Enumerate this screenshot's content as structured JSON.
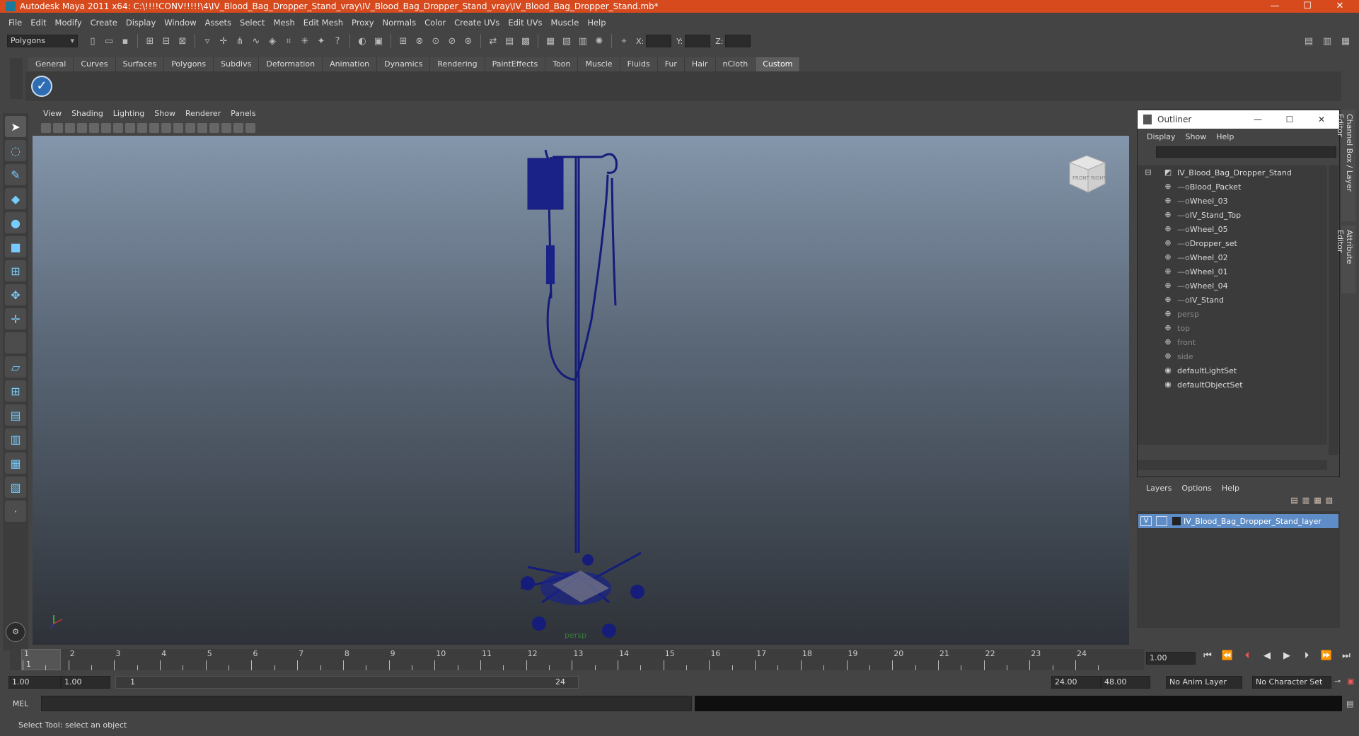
{
  "window": {
    "title": "Autodesk Maya 2011 x64: C:\\!!!!CONV!!!!!\\4\\IV_Blood_Bag_Dropper_Stand_vray\\IV_Blood_Bag_Dropper_Stand_vray\\IV_Blood_Bag_Dropper_Stand.mb*"
  },
  "menubar": [
    "File",
    "Edit",
    "Modify",
    "Create",
    "Display",
    "Window",
    "Assets",
    "Select",
    "Mesh",
    "Edit Mesh",
    "Proxy",
    "Normals",
    "Color",
    "Create UVs",
    "Edit UVs",
    "Muscle",
    "Help"
  ],
  "statusline": {
    "mode": "Polygons",
    "x_label": "X:",
    "y_label": "Y:",
    "z_label": "Z:"
  },
  "shelf_tabs": [
    "General",
    "Curves",
    "Surfaces",
    "Polygons",
    "Subdivs",
    "Deformation",
    "Animation",
    "Dynamics",
    "Rendering",
    "PaintEffects",
    "Toon",
    "Muscle",
    "Fluids",
    "Fur",
    "Hair",
    "nCloth",
    "Custom"
  ],
  "shelf_active": "Custom",
  "viewport": {
    "menu": [
      "View",
      "Shading",
      "Lighting",
      "Show",
      "Renderer",
      "Panels"
    ],
    "camera_label": "persp",
    "viewcube_faces": [
      "FRONT",
      "RIGHT"
    ]
  },
  "outliner": {
    "title": "Outliner",
    "menu": [
      "Display",
      "Show",
      "Help"
    ],
    "items": [
      {
        "label": "IV_Blood_Bag_Dropper_Stand",
        "indent": 0,
        "dim": false
      },
      {
        "label": "Blood_Packet",
        "indent": 1,
        "dim": false
      },
      {
        "label": "Wheel_03",
        "indent": 1,
        "dim": false
      },
      {
        "label": "IV_Stand_Top",
        "indent": 1,
        "dim": false
      },
      {
        "label": "Wheel_05",
        "indent": 1,
        "dim": false
      },
      {
        "label": "Dropper_set",
        "indent": 1,
        "dim": false
      },
      {
        "label": "Wheel_02",
        "indent": 1,
        "dim": false
      },
      {
        "label": "Wheel_01",
        "indent": 1,
        "dim": false
      },
      {
        "label": "Wheel_04",
        "indent": 1,
        "dim": false
      },
      {
        "label": "IV_Stand",
        "indent": 1,
        "dim": false
      },
      {
        "label": "persp",
        "indent": 0,
        "dim": true
      },
      {
        "label": "top",
        "indent": 0,
        "dim": true
      },
      {
        "label": "front",
        "indent": 0,
        "dim": true
      },
      {
        "label": "side",
        "indent": 0,
        "dim": true
      },
      {
        "label": "defaultLightSet",
        "indent": 0,
        "dim": false
      },
      {
        "label": "defaultObjectSet",
        "indent": 0,
        "dim": false
      }
    ]
  },
  "layers": {
    "menu": [
      "Layers",
      "Options",
      "Help"
    ],
    "layer": {
      "visible": "V",
      "name": "IV_Blood_Bag_Dropper_Stand_layer"
    }
  },
  "side_tabs": [
    "Channel Box / Layer Editor",
    "Attribute Editor"
  ],
  "timeline": {
    "ticks": [
      "1",
      "2",
      "3",
      "4",
      "5",
      "6",
      "7",
      "8",
      "9",
      "10",
      "11",
      "12",
      "13",
      "14",
      "15",
      "16",
      "17",
      "18",
      "19",
      "20",
      "21",
      "22",
      "23",
      "24"
    ],
    "current": "1",
    "current_frame_field": "1.00"
  },
  "range": {
    "start_field": "1.00",
    "start2_field": "1.00",
    "slider_start": "1",
    "slider_end": "24",
    "end_field": "24.00",
    "end2_field": "48.00",
    "anim_layer": "No Anim Layer",
    "char_set": "No Character Set"
  },
  "mel": {
    "label": "MEL"
  },
  "help_line": "Select Tool: select an object",
  "colors": {
    "title_bar": "#d64a1e",
    "model_wire": "#151c7a",
    "layer_highlight": "#5d8cc6"
  }
}
